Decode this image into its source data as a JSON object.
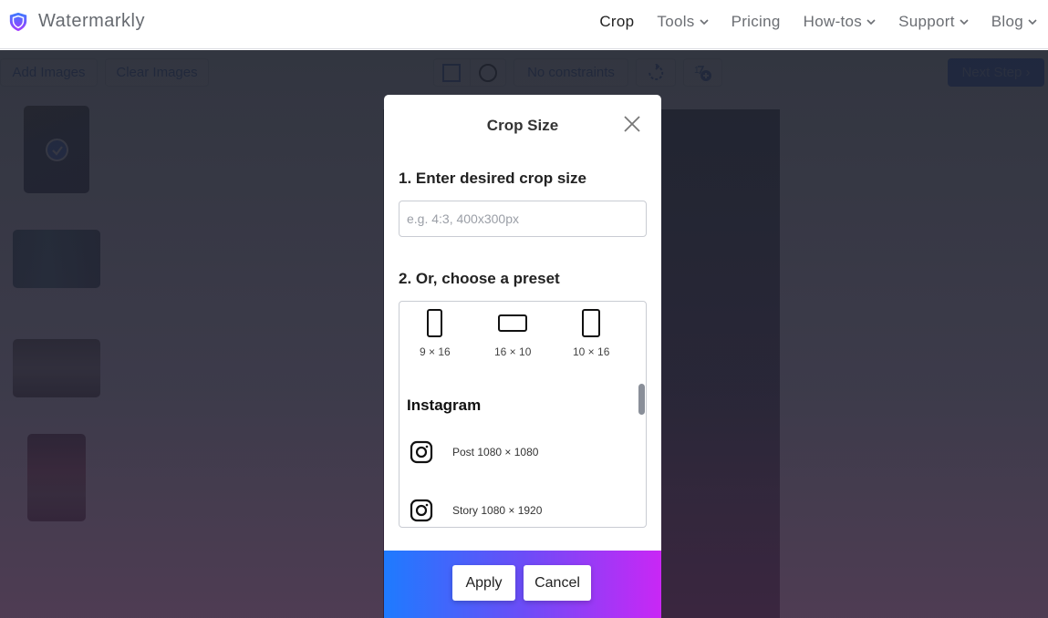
{
  "header": {
    "brand": "Watermarkly",
    "brand_gradient": [
      "#3b7bff",
      "#a63bff"
    ],
    "nav": [
      {
        "label": "Crop",
        "active": true,
        "dropdown": false
      },
      {
        "label": "Tools",
        "active": false,
        "dropdown": true
      },
      {
        "label": "Pricing",
        "active": false,
        "dropdown": false
      },
      {
        "label": "How-tos",
        "active": false,
        "dropdown": true
      },
      {
        "label": "Support",
        "active": false,
        "dropdown": true
      },
      {
        "label": "Blog",
        "active": false,
        "dropdown": true
      }
    ]
  },
  "toolbar": {
    "add_images": "Add Images",
    "clear_images": "Clear Images",
    "shape_rect": "rectangle-icon",
    "shape_circle": "circle-icon",
    "constraints": "No constraints",
    "rotate": "rotate-icon",
    "add_watermark": "add-watermark-icon",
    "next_step": "Next Step",
    "next_arrow": "›"
  },
  "thumbnails": [
    {
      "selected": true
    },
    {
      "selected": false
    },
    {
      "selected": false
    },
    {
      "selected": false
    }
  ],
  "modal": {
    "title": "Crop Size",
    "step1_label": "1. Enter desired crop size",
    "input_value": "",
    "input_placeholder": "e.g. 4:3, 400x300px",
    "step2_label": "2. Or, choose a preset",
    "ratios": [
      {
        "label": "9 × 16"
      },
      {
        "label": "16 × 10"
      },
      {
        "label": "10 × 16"
      }
    ],
    "section": "Instagram",
    "presets": [
      {
        "label": "Post 1080 × 1080",
        "icon": "instagram-icon"
      },
      {
        "label": "Story 1080 × 1920",
        "icon": "instagram-icon"
      }
    ],
    "apply": "Apply",
    "cancel": "Cancel",
    "footer_gradient": [
      "#1e7bff",
      "#c927f5"
    ]
  }
}
